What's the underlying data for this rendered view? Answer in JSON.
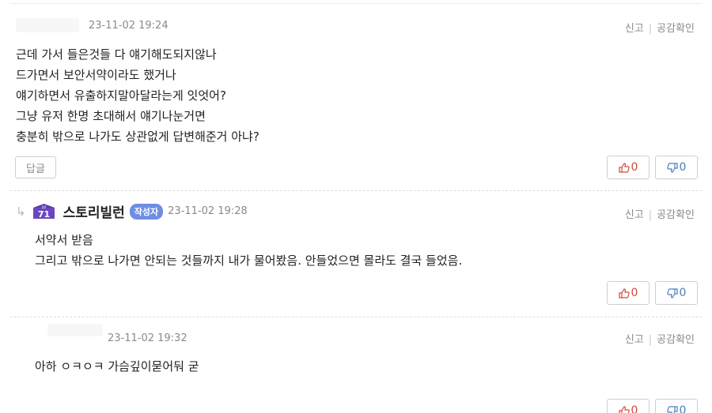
{
  "comments": [
    {
      "time": "23-11-02 19:24",
      "actions": {
        "report": "신고",
        "separator": "|",
        "check_likes": "공감확인"
      },
      "lines": [
        "근데 가서 들은것들 다 얘기해도되지않나",
        "드가면서 보안서약이라도 했거나",
        "얘기하면서 유출하지말아달라는게 잇엇어?",
        "그냥 유저 한명 초대해서 얘기나눈거면",
        "충분히 밖으로 나가도 상관없게 답변해준거 아냐?"
      ],
      "reply_label": "답글",
      "likes": "0",
      "dislikes": "0"
    },
    {
      "level": "71",
      "level_prefix": "LV",
      "nickname": "스토리빌런",
      "writer_badge": "작성자",
      "time": "23-11-02 19:28",
      "actions": {
        "report": "신고",
        "separator": "|",
        "check_likes": "공감확인"
      },
      "lines": [
        "서약서 받음",
        "그리고 밖으로 나가면 안되는 것들까지 내가 물어봤음. 안들었으면 몰라도 결국 들었음."
      ],
      "likes": "0",
      "dislikes": "0"
    },
    {
      "time": "23-11-02 19:32",
      "actions": {
        "report": "신고",
        "separator": "|",
        "check_likes": "공감확인"
      },
      "lines": [
        "아하 ㅇㅋㅇㅋ 가슴깊이묻어둬 굳"
      ],
      "likes": "0",
      "dislikes": "0"
    }
  ],
  "colors": {
    "like": "#d04a3c",
    "dislike": "#4a7fc0",
    "writer_badge": "#6f8de3",
    "level_badge": "#5b3aa8"
  },
  "icons": {
    "like": "thumbs-up-icon",
    "dislike": "thumbs-down-icon",
    "reply_arrow": "reply-arrow-icon",
    "level": "level-badge-icon"
  }
}
